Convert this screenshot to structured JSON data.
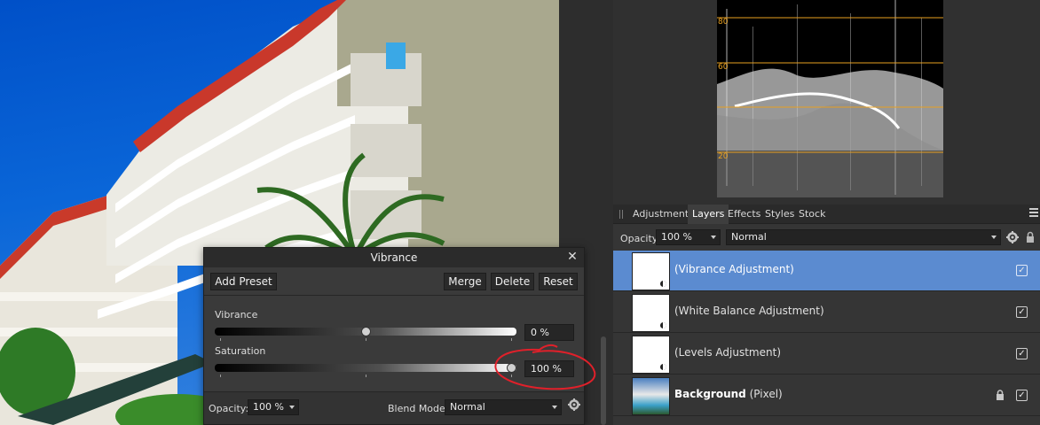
{
  "dialog": {
    "title": "Vibrance",
    "buttons": {
      "add_preset": "Add Preset",
      "merge": "Merge",
      "delete": "Delete",
      "reset": "Reset"
    },
    "sliders": [
      {
        "label": "Vibrance",
        "value": "0 %",
        "level": 0.5
      },
      {
        "label": "Saturation",
        "value": "100 %",
        "level": 1.0
      }
    ],
    "footer": {
      "opacity_label": "Opacity:",
      "opacity_value": "100 %",
      "blend_label": "Blend Mode:",
      "blend_value": "Normal"
    }
  },
  "scope": {
    "grid_labels": [
      "80",
      "60",
      "20"
    ]
  },
  "panel": {
    "tabs": [
      "Adjustment",
      "Layers",
      "Effects",
      "Styles",
      "Stock"
    ],
    "active_tab": "Layers",
    "opacity_label": "Opacity:",
    "opacity_value": "100 %",
    "blend_value": "Normal",
    "layers": [
      {
        "name": "(Vibrance Adjustment)",
        "selected": true,
        "visible": true
      },
      {
        "name": "(White Balance Adjustment)",
        "selected": false,
        "visible": true
      },
      {
        "name": "(Levels Adjustment)",
        "selected": false,
        "visible": true
      },
      {
        "name": "Background",
        "type": "(Pixel)",
        "selected": false,
        "visible": true,
        "locked": true
      }
    ]
  },
  "colors": {
    "selection": "#5b8bd0",
    "annotation": "#e0202a",
    "scope_grid": "#e8a020"
  }
}
